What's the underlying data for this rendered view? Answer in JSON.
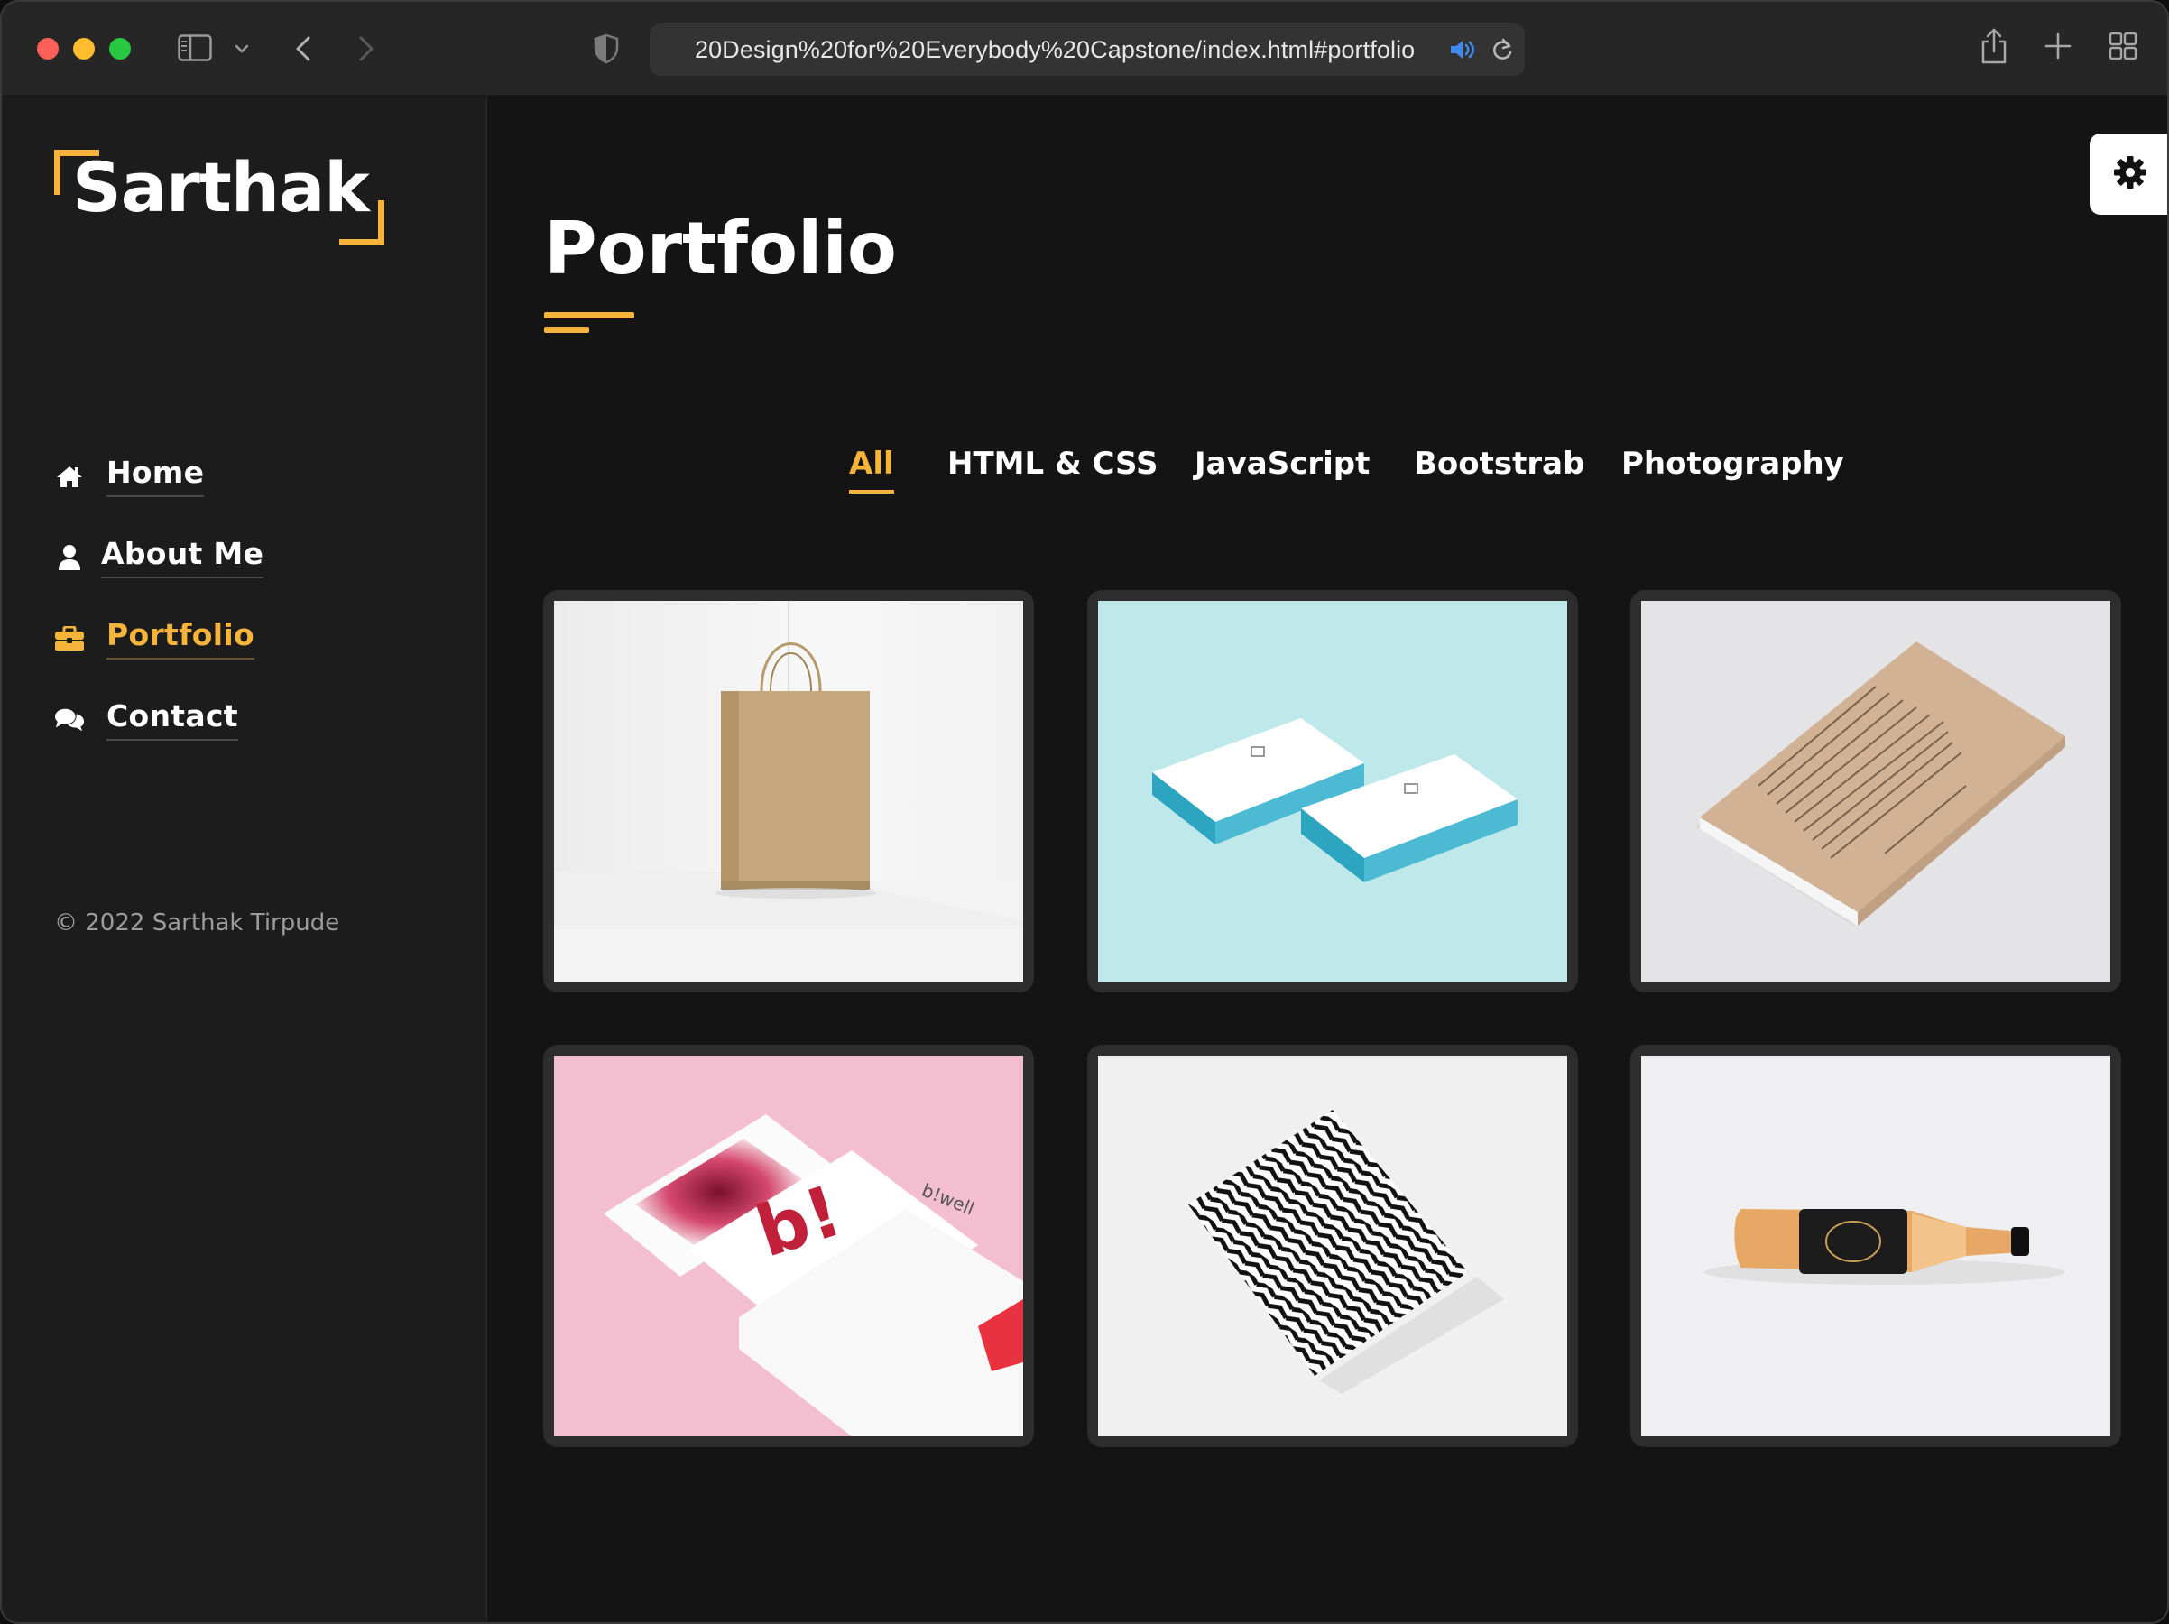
{
  "browser": {
    "url": "20Design%20for%20Everybody%20Capstone/index.html#portfolio"
  },
  "sidebar": {
    "logo": "Sarthak",
    "nav": [
      {
        "label": "Home",
        "icon": "home-icon"
      },
      {
        "label": "About Me",
        "icon": "user-icon"
      },
      {
        "label": "Portfolio",
        "icon": "briefcase-icon",
        "active": true
      },
      {
        "label": "Contact",
        "icon": "comments-icon"
      }
    ],
    "copyright": "© 2022 Sarthak Tirpude"
  },
  "main": {
    "title": "Portfolio",
    "filters": [
      {
        "label": "All",
        "active": true
      },
      {
        "label": "HTML & CSS"
      },
      {
        "label": "JavaScript"
      },
      {
        "label": "Bootstrab"
      },
      {
        "label": "Photography"
      }
    ],
    "items": [
      {
        "name": "paper-bag-mockup"
      },
      {
        "name": "business-cards-mockup"
      },
      {
        "name": "book-cover-mockup"
      },
      {
        "name": "branding-stationery-mockup"
      },
      {
        "name": "pattern-poster-mockup"
      },
      {
        "name": "bottle-mockup"
      }
    ],
    "mockup_text": {
      "bwell": "b!well",
      "bi": "b!"
    }
  },
  "colors": {
    "accent": "#f6b53a",
    "sidebar_bg": "#1c1c1c",
    "main_bg": "#141414",
    "card_bg": "#2d2d2d"
  }
}
